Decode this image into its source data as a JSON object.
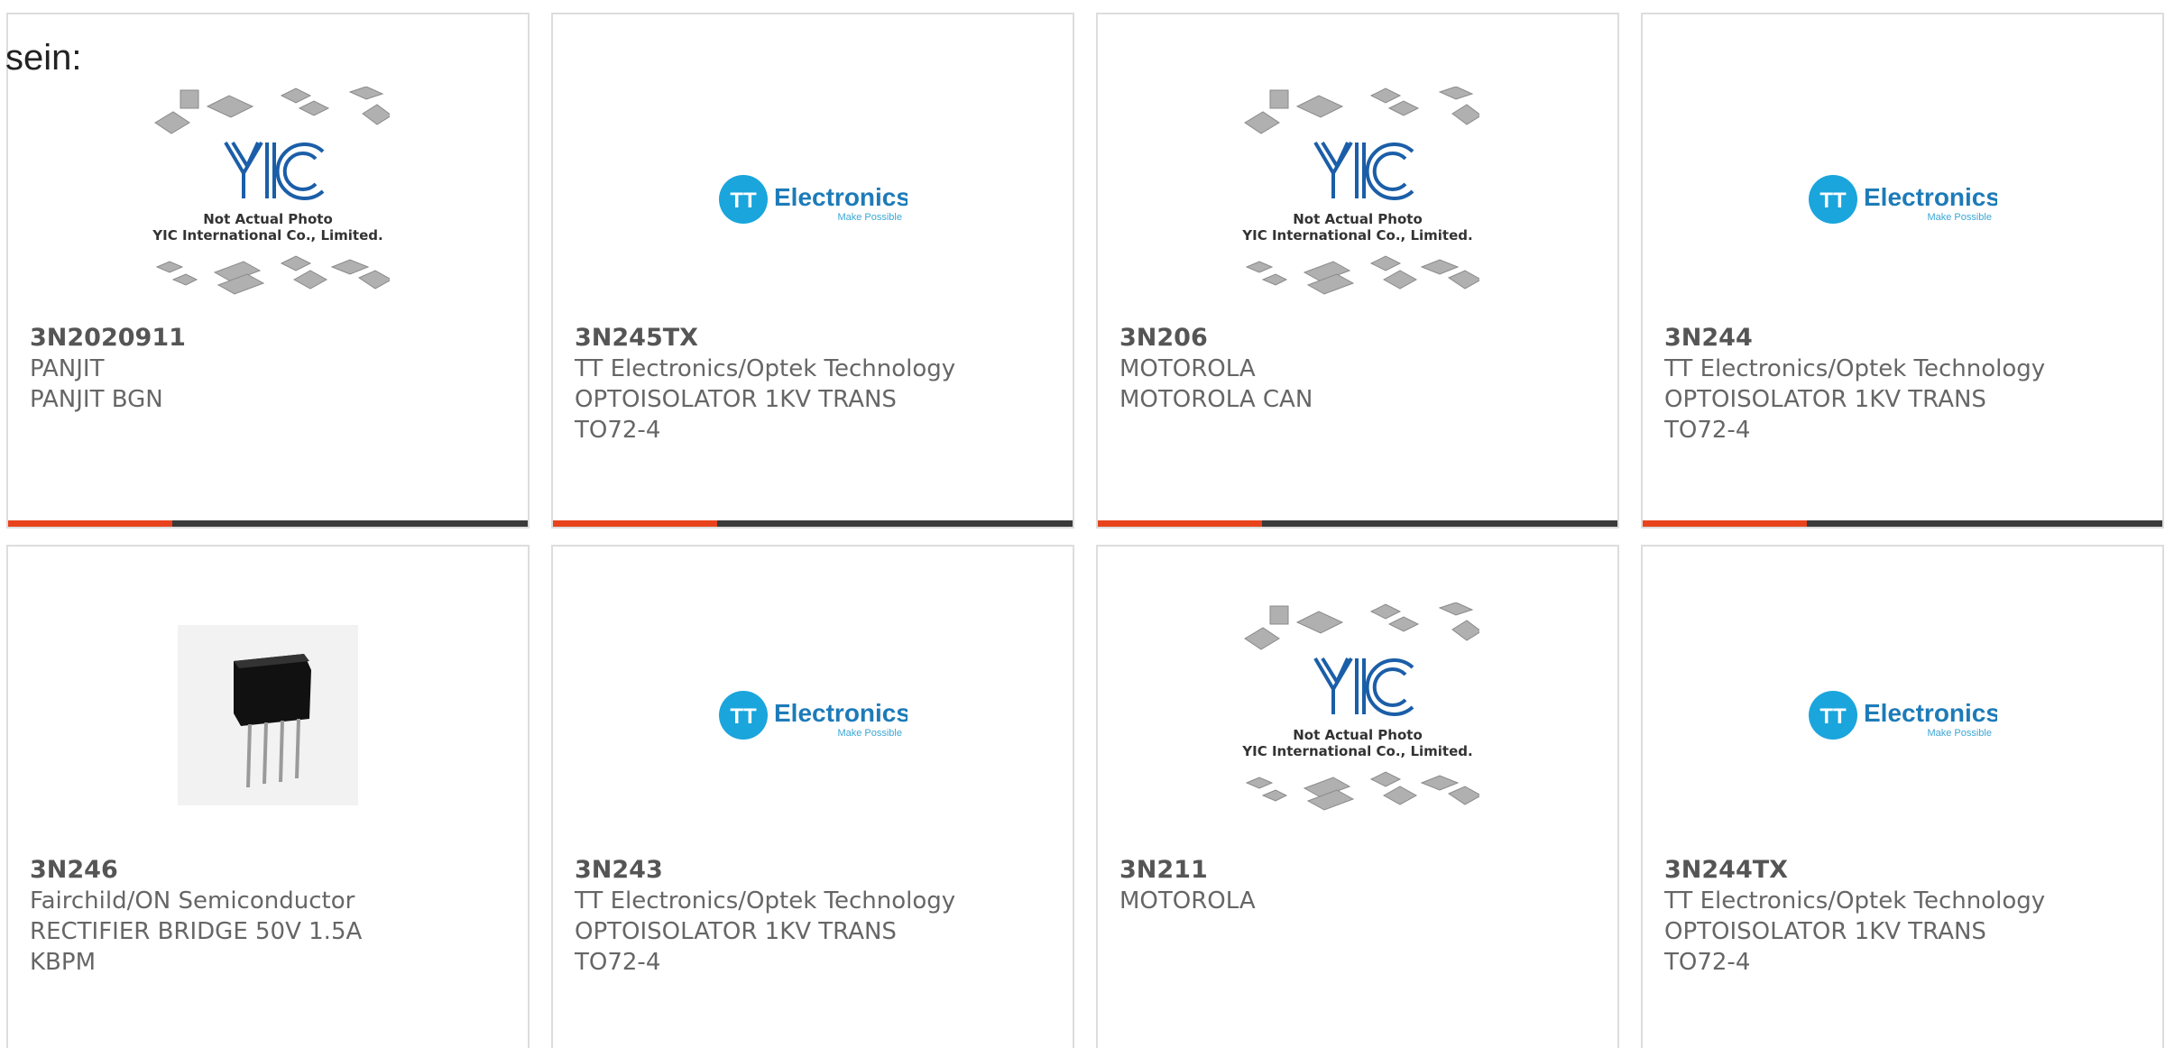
{
  "intro_text": "sein:",
  "products": [
    {
      "part": "3N2020911",
      "manufacturer": "PANJIT",
      "lines": [
        "PANJIT BGN"
      ],
      "image": "yic-placeholder"
    },
    {
      "part": "3N245TX",
      "manufacturer": "TT Electronics/Optek Technology",
      "lines": [
        "OPTOISOLATOR 1KV TRANS",
        "TO72-4"
      ],
      "image": "tt-electronics-logo"
    },
    {
      "part": "3N206",
      "manufacturer": "MOTOROLA",
      "lines": [
        "MOTOROLA CAN"
      ],
      "image": "yic-placeholder"
    },
    {
      "part": "3N244",
      "manufacturer": "TT Electronics/Optek Technology",
      "lines": [
        "OPTOISOLATOR 1KV TRANS",
        "TO72-4"
      ],
      "image": "tt-electronics-logo"
    },
    {
      "part": "3N246",
      "manufacturer": "Fairchild/ON Semiconductor",
      "lines": [
        "RECTIFIER BRIDGE 50V 1.5A",
        "KBPM"
      ],
      "image": "bridge-rectifier-photo"
    },
    {
      "part": "3N243",
      "manufacturer": "TT Electronics/Optek Technology",
      "lines": [
        "OPTOISOLATOR 1KV TRANS",
        "TO72-4"
      ],
      "image": "tt-electronics-logo"
    },
    {
      "part": "3N211",
      "manufacturer": "MOTOROLA",
      "lines": [],
      "image": "yic-placeholder"
    },
    {
      "part": "3N244TX",
      "manufacturer": "TT Electronics/Optek Technology",
      "lines": [
        "OPTOISOLATOR 1KV TRANS",
        "TO72-4"
      ],
      "image": "tt-electronics-logo"
    }
  ],
  "yic_logo": {
    "mark": "YIC",
    "caption1": "Not Actual Photo",
    "caption2": "YIC International Co., Limited."
  },
  "tt_logo": {
    "mark": "TT",
    "word": "Electronics",
    "tagline": "Make Possible"
  },
  "colors": {
    "accent": "#e8431c",
    "bar": "#3a3a3a",
    "tt_blue": "#1aa5dc",
    "yic_blue": "#1b5ea8",
    "border": "#dddddd"
  }
}
